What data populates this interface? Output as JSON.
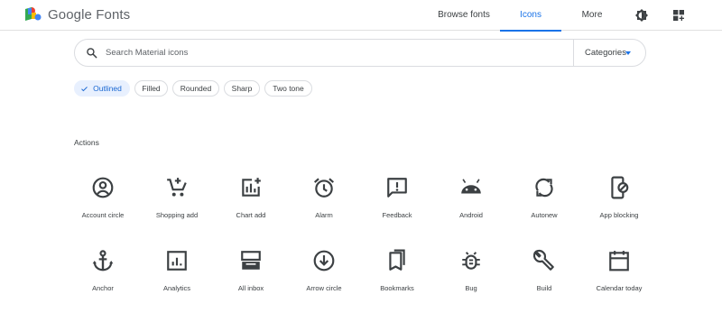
{
  "header": {
    "brand": "Google Fonts",
    "nav": [
      {
        "label": "Browse fonts"
      },
      {
        "label": "Icons",
        "active": true
      },
      {
        "label": "More"
      }
    ],
    "accent_color": "#1a73e8",
    "icons": [
      "theme-toggle-icon",
      "apps-grid-icon"
    ]
  },
  "search": {
    "placeholder": "Search Material icons",
    "value": "",
    "categories_label": "Categories"
  },
  "styles": [
    {
      "label": "Outlined",
      "selected": true
    },
    {
      "label": "Filled",
      "selected": false
    },
    {
      "label": "Rounded",
      "selected": false
    },
    {
      "label": "Sharp",
      "selected": false
    },
    {
      "label": "Two tone",
      "selected": false
    }
  ],
  "section": {
    "title": "Actions",
    "icons": [
      {
        "label": "Account circle",
        "icon": "account-circle-icon"
      },
      {
        "label": "Shopping add",
        "icon": "shopping-add-icon"
      },
      {
        "label": "Chart add",
        "icon": "chart-add-icon"
      },
      {
        "label": "Alarm",
        "icon": "alarm-icon"
      },
      {
        "label": "Feedback",
        "icon": "feedback-icon"
      },
      {
        "label": "Android",
        "icon": "android-icon"
      },
      {
        "label": "Autonew",
        "icon": "autonew-icon"
      },
      {
        "label": "App blocking",
        "icon": "app-blocking-icon"
      },
      {
        "label": "Anchor",
        "icon": "anchor-icon"
      },
      {
        "label": "Analytics",
        "icon": "analytics-icon"
      },
      {
        "label": "All inbox",
        "icon": "all-inbox-icon"
      },
      {
        "label": "Arrow circle",
        "icon": "arrow-circle-icon"
      },
      {
        "label": "Bookmarks",
        "icon": "bookmarks-icon"
      },
      {
        "label": "Bug",
        "icon": "bug-icon"
      },
      {
        "label": "Build",
        "icon": "build-icon"
      },
      {
        "label": "Calendar today",
        "icon": "calendar-today-icon"
      }
    ]
  }
}
